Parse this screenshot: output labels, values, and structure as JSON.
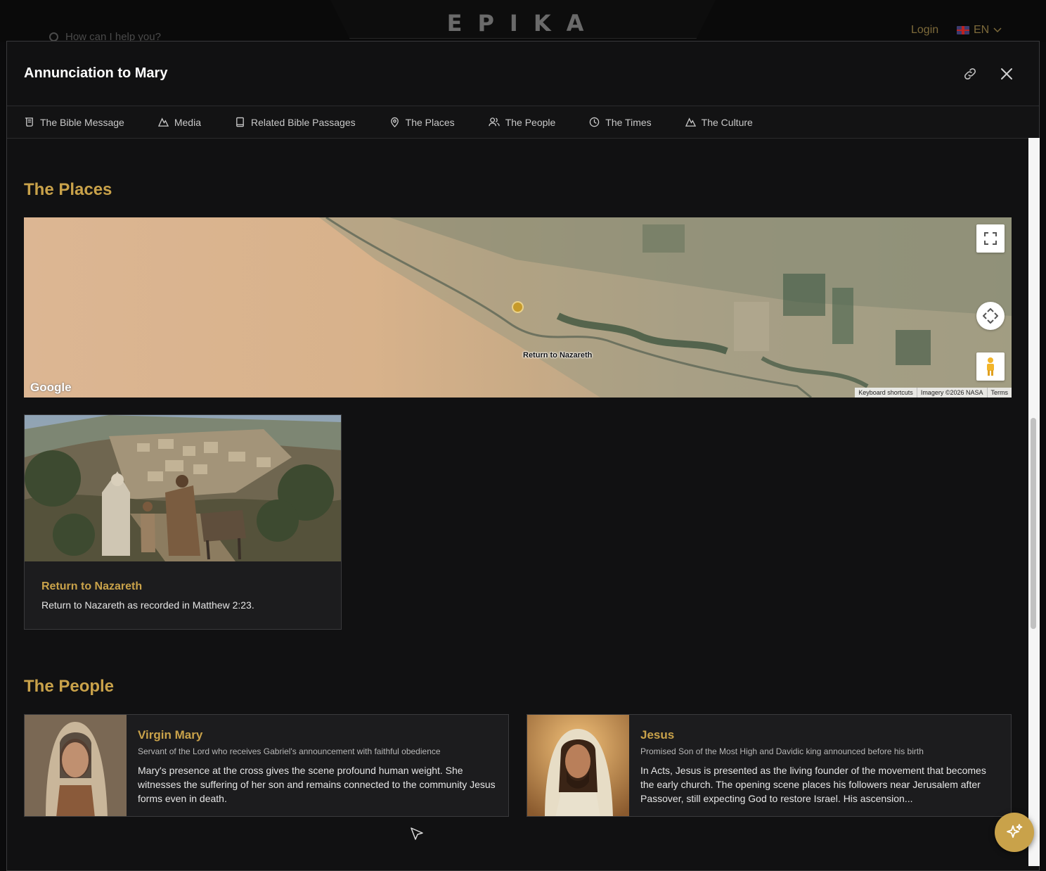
{
  "site": {
    "search_placeholder": "How can I help you?",
    "logo": "EPIKA",
    "login": "Login",
    "language": "EN"
  },
  "modal": {
    "title": "Annunciation to Mary",
    "tabs": [
      {
        "label": "The Bible Message",
        "icon": "scroll-icon"
      },
      {
        "label": "Media",
        "icon": "mountain-icon"
      },
      {
        "label": "Related Bible Passages",
        "icon": "book-icon"
      },
      {
        "label": "The Places",
        "icon": "map-pin-icon"
      },
      {
        "label": "The People",
        "icon": "users-icon"
      },
      {
        "label": "The Times",
        "icon": "clock-icon"
      },
      {
        "label": "The Culture",
        "icon": "mountain-icon"
      }
    ]
  },
  "places": {
    "heading": "The Places",
    "map": {
      "marker_label": "Return to Nazareth",
      "google": "Google",
      "attribution": [
        "Keyboard shortcuts",
        "Imagery ©2026 NASA",
        "Terms"
      ]
    },
    "cards": [
      {
        "name": "Return to Nazareth",
        "description": "Return to Nazareth as recorded in Matthew 2:23."
      }
    ]
  },
  "people": {
    "heading": "The People",
    "cards": [
      {
        "name": "Virgin Mary",
        "subtitle": "Servant of the Lord who receives Gabriel's announcement with faithful obedience",
        "bio": "Mary's presence at the cross gives the scene profound human weight. She witnesses the suffering of her son and remains connected to the community Jesus forms even in death."
      },
      {
        "name": "Jesus",
        "subtitle": "Promised Son of the Most High and Davidic king announced before his birth",
        "bio": "In Acts, Jesus is presented as the living founder of the movement that becomes the early church. The opening scene places his followers near Jerusalem after Passover, still expecting God to restore Israel. His ascension..."
      }
    ]
  },
  "colors": {
    "accent": "#c9a24a",
    "background": "#111112",
    "card": "#1c1c1e"
  }
}
